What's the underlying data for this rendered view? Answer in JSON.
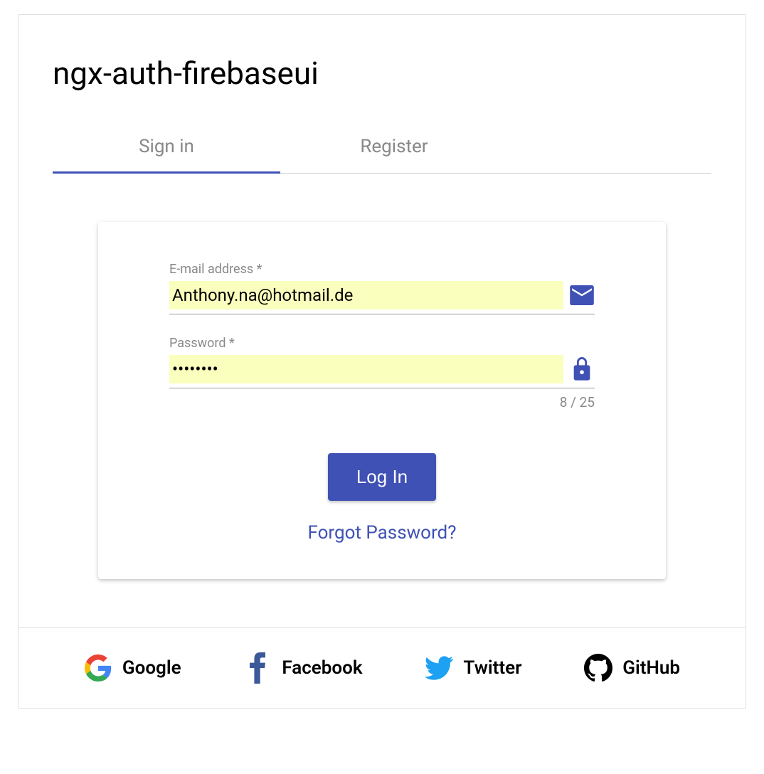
{
  "title": "ngx-auth-firebaseui",
  "tabs": {
    "signin": "Sign in",
    "register": "Register"
  },
  "form": {
    "email_label": "E-mail address *",
    "email_value": "Anthony.na@hotmail.de",
    "password_label": "Password *",
    "password_value": "••••••••",
    "counter": "8 / 25",
    "login_button": "Log In",
    "forgot_link": "Forgot Password?"
  },
  "providers": {
    "google": "Google",
    "facebook": "Facebook",
    "twitter": "Twitter",
    "github": "GitHub"
  }
}
